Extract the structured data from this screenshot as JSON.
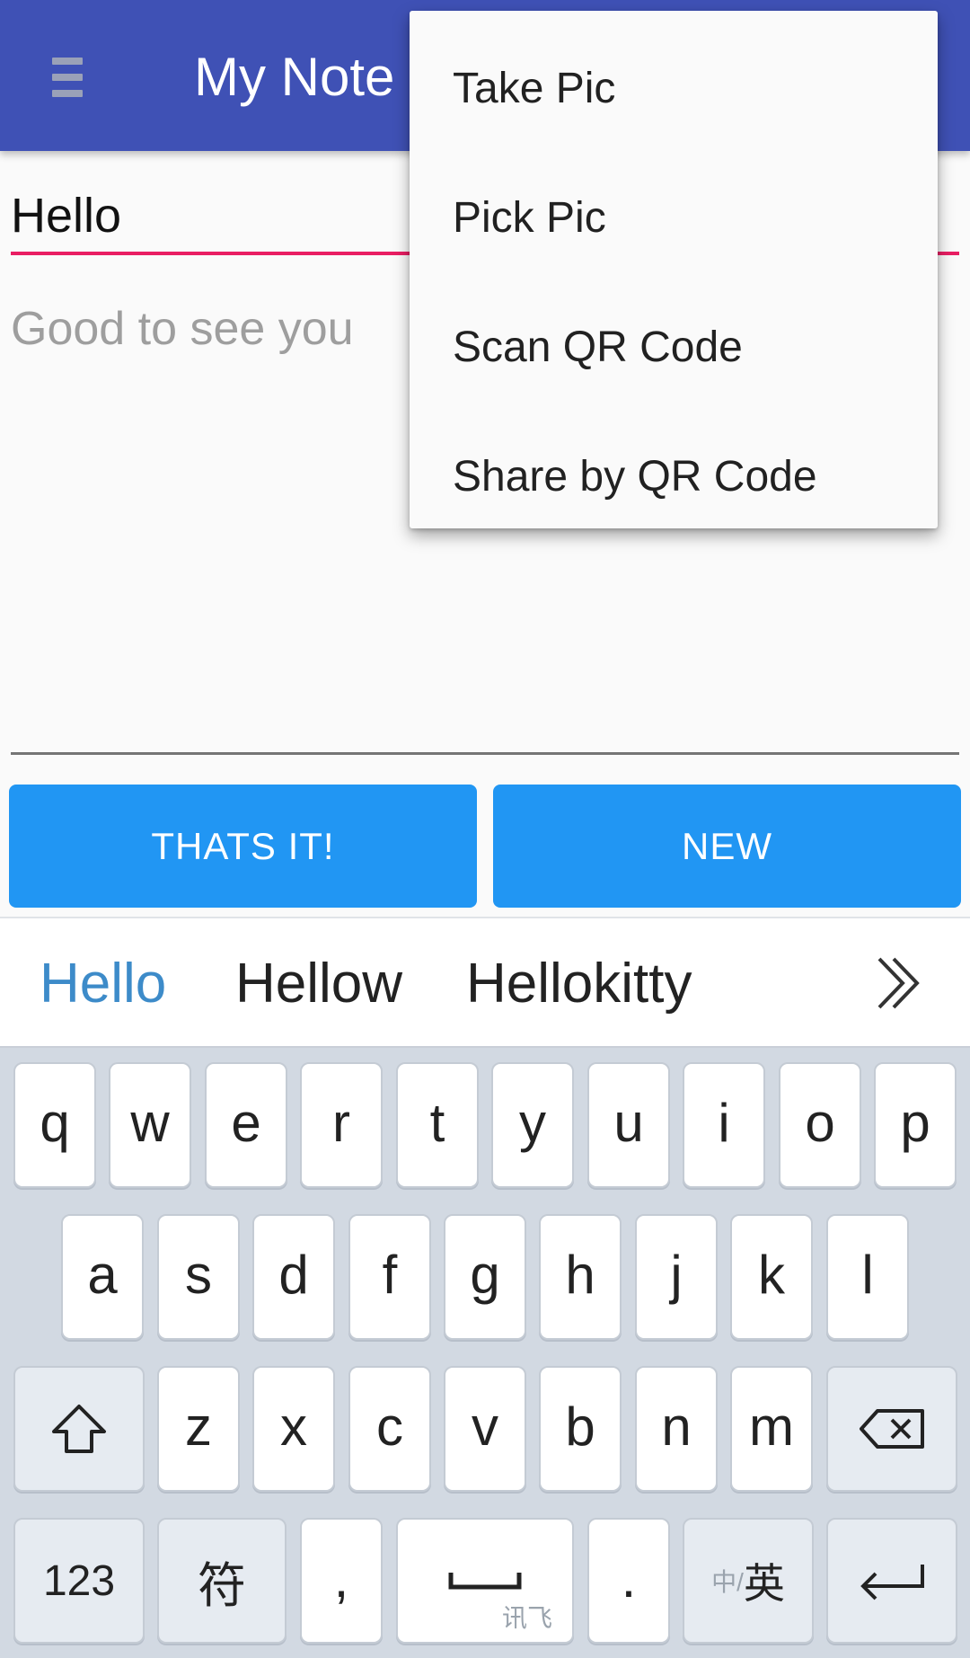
{
  "app_bar": {
    "title": "My Note",
    "menu_icon": "hamburger-menu-icon",
    "color": "#3f51b5"
  },
  "note": {
    "title_value": "Hello",
    "body_placeholder": "Good to see you",
    "accent_color": "#e91e63"
  },
  "buttons": {
    "save_label": "THATS IT!",
    "new_label": "NEW",
    "color": "#2196f3"
  },
  "overflow_menu": {
    "items": [
      {
        "label": "Take Pic"
      },
      {
        "label": "Pick Pic"
      },
      {
        "label": "Scan QR Code"
      },
      {
        "label": "Share by QR Code"
      }
    ]
  },
  "keyboard": {
    "suggestions": [
      "Hello",
      "Hellow",
      "Hellokitty"
    ],
    "more_icon": "chevron-double-right-icon",
    "row1": [
      "q",
      "w",
      "e",
      "r",
      "t",
      "y",
      "u",
      "i",
      "o",
      "p"
    ],
    "row2": [
      "a",
      "s",
      "d",
      "f",
      "g",
      "h",
      "j",
      "k",
      "l"
    ],
    "row3": [
      "z",
      "x",
      "c",
      "v",
      "b",
      "n",
      "m"
    ],
    "row4": {
      "numbers": "123",
      "symbols": "符",
      "comma": ",",
      "space_brand": "讯飞",
      "period": ".",
      "lang_small": "中/",
      "lang_big": "英"
    },
    "icons": {
      "shift": "shift-icon",
      "backspace": "backspace-icon",
      "space": "space-bar-icon",
      "enter": "enter-icon"
    }
  }
}
